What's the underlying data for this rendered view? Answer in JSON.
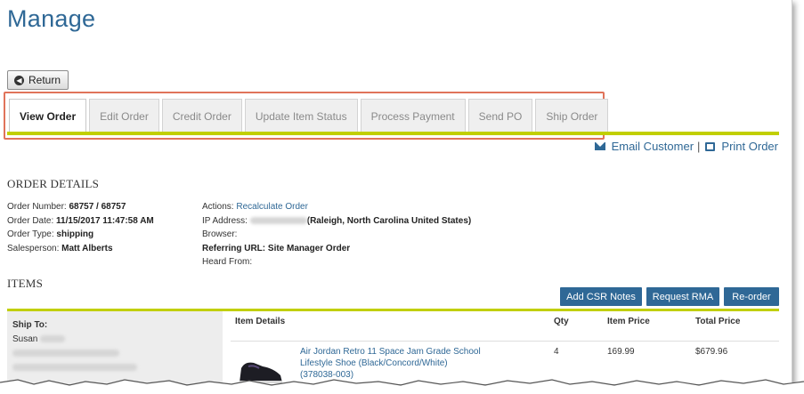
{
  "page": {
    "title": "Manage"
  },
  "return_button": {
    "label": "Return",
    "icon": "arrow-left-circle-icon"
  },
  "tabs": [
    {
      "label": "View Order",
      "active": true
    },
    {
      "label": "Edit Order",
      "active": false
    },
    {
      "label": "Credit Order",
      "active": false
    },
    {
      "label": "Update Item Status",
      "active": false
    },
    {
      "label": "Process Payment",
      "active": false
    },
    {
      "label": "Send PO",
      "active": false
    },
    {
      "label": "Ship Order",
      "active": false
    }
  ],
  "toolbar": {
    "email_label": "Email Customer",
    "separator": "|",
    "print_label": "Print Order"
  },
  "order_details": {
    "heading": "ORDER DETAILS",
    "order_number_label": "Order Number:",
    "order_number": "68757 / 68757",
    "order_date_label": "Order Date:",
    "order_date": "11/15/2017 11:47:58 AM",
    "order_type_label": "Order Type:",
    "order_type": "shipping",
    "salesperson_label": "Salesperson:",
    "salesperson": "Matt Alberts",
    "actions_label": "Actions:",
    "actions_link": "Recalculate Order",
    "ip_label": "IP Address:",
    "ip_location": "(Raleigh, North Carolina United States)",
    "browser_label": "Browser:",
    "referring_label": "Referring URL:",
    "referring_value": "Site Manager Order",
    "heard_label": "Heard From:"
  },
  "items": {
    "heading": "ITEMS",
    "buttons": {
      "csr_notes": "Add CSR Notes",
      "request_rma": "Request RMA",
      "reorder": "Re-order"
    },
    "ship_to_label": "Ship To:",
    "ship_to_name": "Susan",
    "columns": {
      "details": "Item Details",
      "qty": "Qty",
      "price": "Item Price",
      "total": "Total Price"
    },
    "rows": [
      {
        "name_line1": "Air Jordan Retro 11 Space Jam Grade School",
        "name_line2": "Lifestyle Shoe (Black/Concord/White)",
        "sku": "(378038-003)",
        "qty": "4",
        "price": "169.99",
        "total": "$679.96"
      }
    ]
  },
  "colors": {
    "accent": "#2f6896",
    "rule": "#c1cf00",
    "highlight": "#e0735a"
  }
}
